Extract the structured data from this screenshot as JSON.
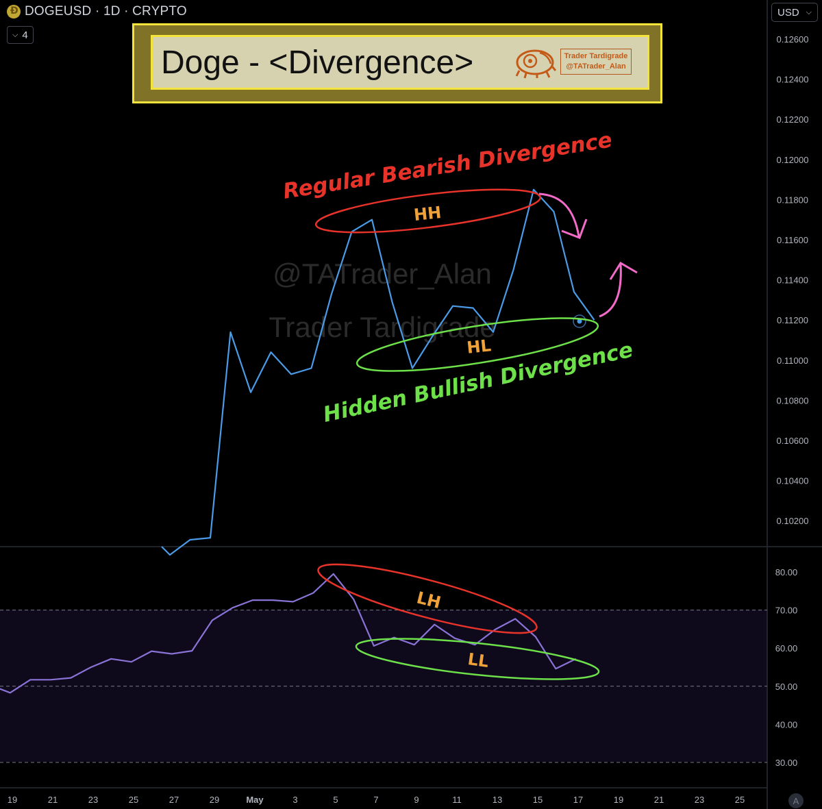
{
  "header": {
    "symbol_line": "DOGEUSD · 1D · CRYPTO",
    "indicator_count": "4",
    "currency": "USD"
  },
  "banner": {
    "title": "Doge - <Divergence>",
    "brand_line1": "Trader Tardigrade",
    "brand_line2": "@TATrader_Alan"
  },
  "watermark": {
    "line1": "@TATrader_Alan",
    "line2": "Trader Tardigrade"
  },
  "annotations": {
    "bearish": "Regular Bearish Divergence",
    "bullish": "Hidden Bullish Divergence",
    "hh": "HH",
    "hl": "HL",
    "lh": "LH",
    "ll": "LL"
  },
  "colors": {
    "price_line": "#4a9be8",
    "rsi_line": "#8a73d6",
    "bearish": "#e8332a",
    "bullish": "#6de04a",
    "marker_text": "#f0a23a",
    "arrow": "#f36bc8",
    "rsi_band": "#0e0a1c",
    "background": "#000000"
  },
  "chart_data": [
    {
      "type": "line",
      "name": "price",
      "x": [
        "Apr 24",
        "Apr 25",
        "Apr 26",
        "Apr 27",
        "Apr 28",
        "Apr 29",
        "Apr 30",
        "May 1",
        "May 2",
        "May 3",
        "May 4",
        "May 5",
        "May 6",
        "May 7",
        "May 8",
        "May 9",
        "May 10",
        "May 11",
        "May 12",
        "May 13",
        "May 14",
        "May 15",
        "May 16",
        "May 17"
      ],
      "y": [
        0.1003,
        0.10105,
        0.10115,
        0.1114,
        0.1084,
        0.1104,
        0.1093,
        0.1096,
        0.1133,
        0.1164,
        0.117,
        0.1129,
        0.1096,
        0.1112,
        0.1127,
        0.1126,
        0.1114,
        0.1145,
        0.1185,
        0.1174,
        0.1134,
        0.112
      ],
      "x_start_index": 2,
      "yticks": [
        "0.12600",
        "0.12400",
        "0.12200",
        "0.12000",
        "0.11800",
        "0.11600",
        "0.11400",
        "0.11200",
        "0.11000",
        "0.10800",
        "0.10600",
        "0.10400",
        "0.10200"
      ],
      "ylim": [
        0.1004,
        0.1269
      ]
    },
    {
      "type": "line",
      "name": "rsi",
      "y": [
        50.3,
        48.3,
        51.7,
        51.7,
        52.2,
        55.0,
        57.2,
        56.4,
        59.2,
        58.5,
        59.3,
        67.3,
        70.6,
        72.6,
        72.6,
        72.2,
        74.5,
        79.5,
        72.8,
        60.6,
        62.8,
        60.9,
        66.2,
        62.6,
        60.9,
        64.9,
        67.7,
        63.0,
        54.6,
        57.2
      ],
      "start_date": "Apr 18",
      "yticks": [
        "80.00",
        "70.00",
        "60.00",
        "50.00",
        "40.00",
        "30.00"
      ],
      "levels": [
        70,
        50,
        30
      ],
      "ylim": [
        27,
        86
      ]
    }
  ],
  "xaxis": {
    "ticks": [
      "19",
      "21",
      "23",
      "25",
      "27",
      "29",
      "May",
      "3",
      "5",
      "7",
      "9",
      "11",
      "13",
      "15",
      "17",
      "19",
      "21",
      "23",
      "25"
    ]
  },
  "autoscale_label": "A"
}
